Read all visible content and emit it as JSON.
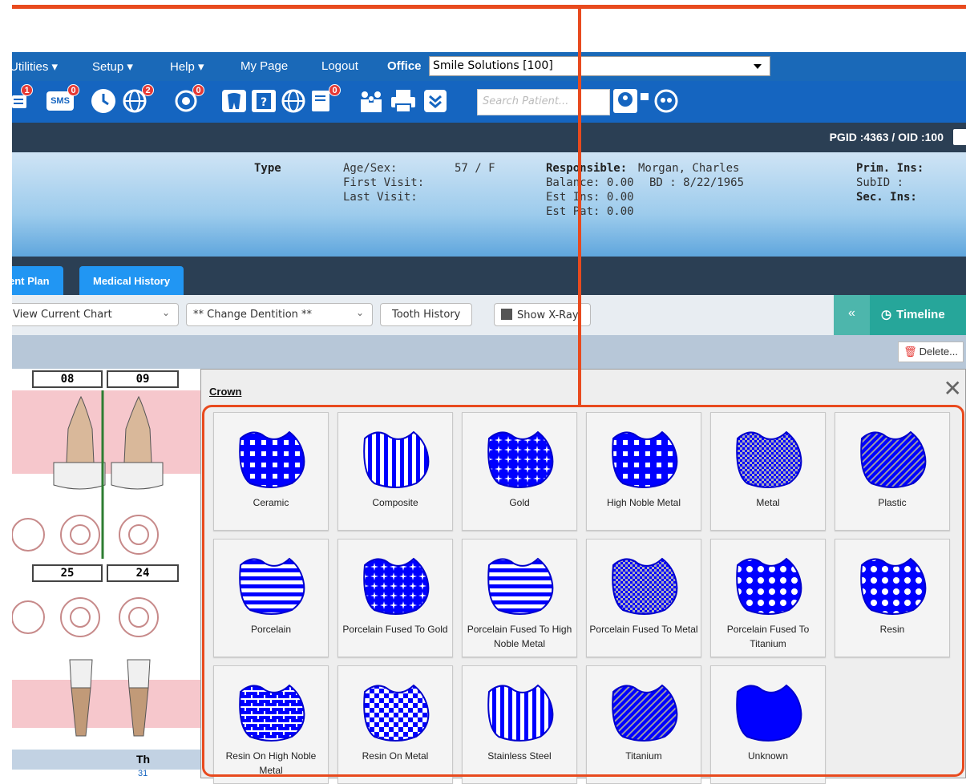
{
  "menu": {
    "utilities": "Utilities ▾",
    "setup": "Setup ▾",
    "help": "Help ▾",
    "mypage": "My Page",
    "logout": "Logout",
    "office_label": "Office",
    "office_value": "Smile Solutions [100]"
  },
  "iconbar": {
    "badges": {
      "chat": "1",
      "sms": "0",
      "globe": "2",
      "recall": "0",
      "docs": "0"
    },
    "sms_text": "SMS",
    "search_placeholder": "Search Patient..."
  },
  "header": {
    "pgid": "PGID :4363  /  OID :100"
  },
  "patient": {
    "type_label": "Type",
    "age_sex_label": "Age/Sex:",
    "age_sex_value": "57 / F",
    "first_visit_label": "First Visit:",
    "last_visit_label": "Last Visit:",
    "responsible_label": "Responsible:",
    "responsible_value": "Morgan, Charles",
    "balance": "Balance: 0.00",
    "bd": "BD : 8/22/1965",
    "est_ins": "Est Ins: 0.00",
    "est_pat": "Est Pat: 0.00",
    "prim_ins": "Prim. Ins:",
    "subid": "SubID :",
    "sec_ins": "Sec. Ins:"
  },
  "tabs": [
    "ent Plan",
    "Medical History"
  ],
  "toolbar": {
    "view_select": "View Current Chart",
    "dentition_select": "** Change Dentition **",
    "tooth_history": "Tooth History",
    "show_xray": "Show X-Ray",
    "timeline": "Timeline",
    "delete": "Delete..."
  },
  "chart": {
    "upper_teeth": [
      "08",
      "09"
    ],
    "lower_teeth": [
      "25",
      "24"
    ],
    "th_header": "Th",
    "row_value": "31"
  },
  "popup": {
    "title": "Crown",
    "close": "✕",
    "items": [
      {
        "label": "Ceramic",
        "pattern": "dots-grid"
      },
      {
        "label": "Composite",
        "pattern": "vertical-stripes"
      },
      {
        "label": "Gold",
        "pattern": "stars"
      },
      {
        "label": "High Noble Metal",
        "pattern": "dots-grid"
      },
      {
        "label": "Metal",
        "pattern": "fine-checker"
      },
      {
        "label": "Plastic",
        "pattern": "diagonal-lines"
      },
      {
        "label": "Porcelain",
        "pattern": "horizontal-stripes"
      },
      {
        "label": "Porcelain Fused To Gold",
        "pattern": "stars"
      },
      {
        "label": "Porcelain Fused To High Noble Metal",
        "pattern": "horizontal-stripes"
      },
      {
        "label": "Porcelain Fused To Metal",
        "pattern": "fine-checker"
      },
      {
        "label": "Porcelain Fused To Titanium",
        "pattern": "white-dots"
      },
      {
        "label": "Resin",
        "pattern": "white-dots"
      },
      {
        "label": "Resin On High Noble Metal",
        "pattern": "brick"
      },
      {
        "label": "Resin On Metal",
        "pattern": "checker"
      },
      {
        "label": "Stainless Steel",
        "pattern": "vertical-stripes"
      },
      {
        "label": "Titanium",
        "pattern": "diagonal-lines"
      },
      {
        "label": "Unknown",
        "pattern": "solid"
      }
    ]
  },
  "colors": {
    "menubar": "#1a69b8",
    "accent_blue": "#0000ff",
    "highlight": "#e84a1e",
    "timeline": "#26a69a"
  }
}
